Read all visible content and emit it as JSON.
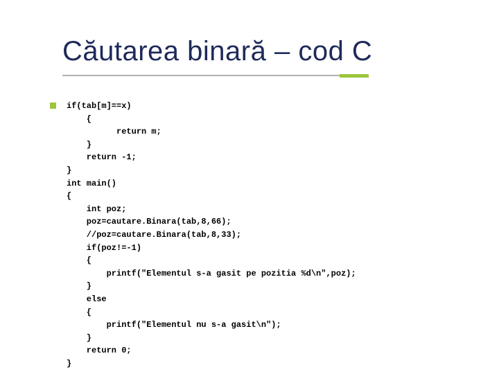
{
  "title": "Căutarea binară – cod C",
  "code": {
    "l01": "if(tab[m]==x)",
    "l02": "    {",
    "l03": "          return m;",
    "l04": "    }",
    "l05": "    return -1;",
    "l06": "}",
    "l07": "int main()",
    "l08": "{",
    "l09": "    int poz;",
    "l10": "    poz=cautare.Binara(tab,8,66);",
    "l11": "    //poz=cautare.Binara(tab,8,33);",
    "l12": "    if(poz!=-1)",
    "l13": "    {",
    "l14": "        printf(\"Elementul s-a gasit pe pozitia %d\\n\",poz);",
    "l15": "    }",
    "l16": "    else",
    "l17": "    {",
    "l18": "        printf(\"Elementul nu s-a gasit\\n\");",
    "l19": "    }",
    "l20": "    return 0;",
    "l21": "}"
  }
}
